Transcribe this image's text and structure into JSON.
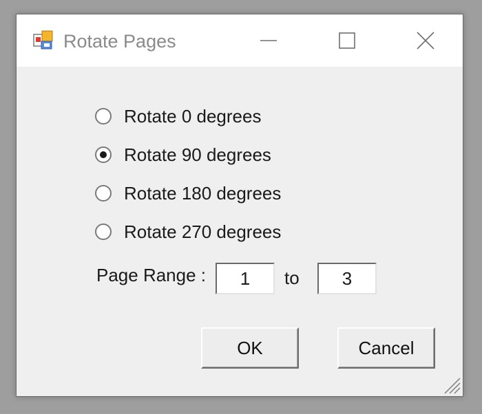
{
  "window": {
    "title": "Rotate Pages",
    "controls": {
      "minimize_icon": "minimize-icon",
      "maximize_icon": "maximize-icon",
      "close_icon": "close-icon"
    },
    "app_icon": "rotate-pages-app-icon"
  },
  "rotation": {
    "options": [
      {
        "label": "Rotate 0 degrees",
        "selected": false
      },
      {
        "label": "Rotate 90 degrees",
        "selected": true
      },
      {
        "label": "Rotate 180 degrees",
        "selected": false
      },
      {
        "label": "Rotate 270 degrees",
        "selected": false
      }
    ]
  },
  "page_range": {
    "label": "Page Range :",
    "from": "1",
    "to_label": "to",
    "to": "3"
  },
  "buttons": {
    "ok": "OK",
    "cancel": "Cancel"
  },
  "colors": {
    "dialog_background": "#efefef",
    "titlebar_background": "#ffffff",
    "title_text": "#8a8a8a",
    "desktop": "#9e9e9e"
  }
}
